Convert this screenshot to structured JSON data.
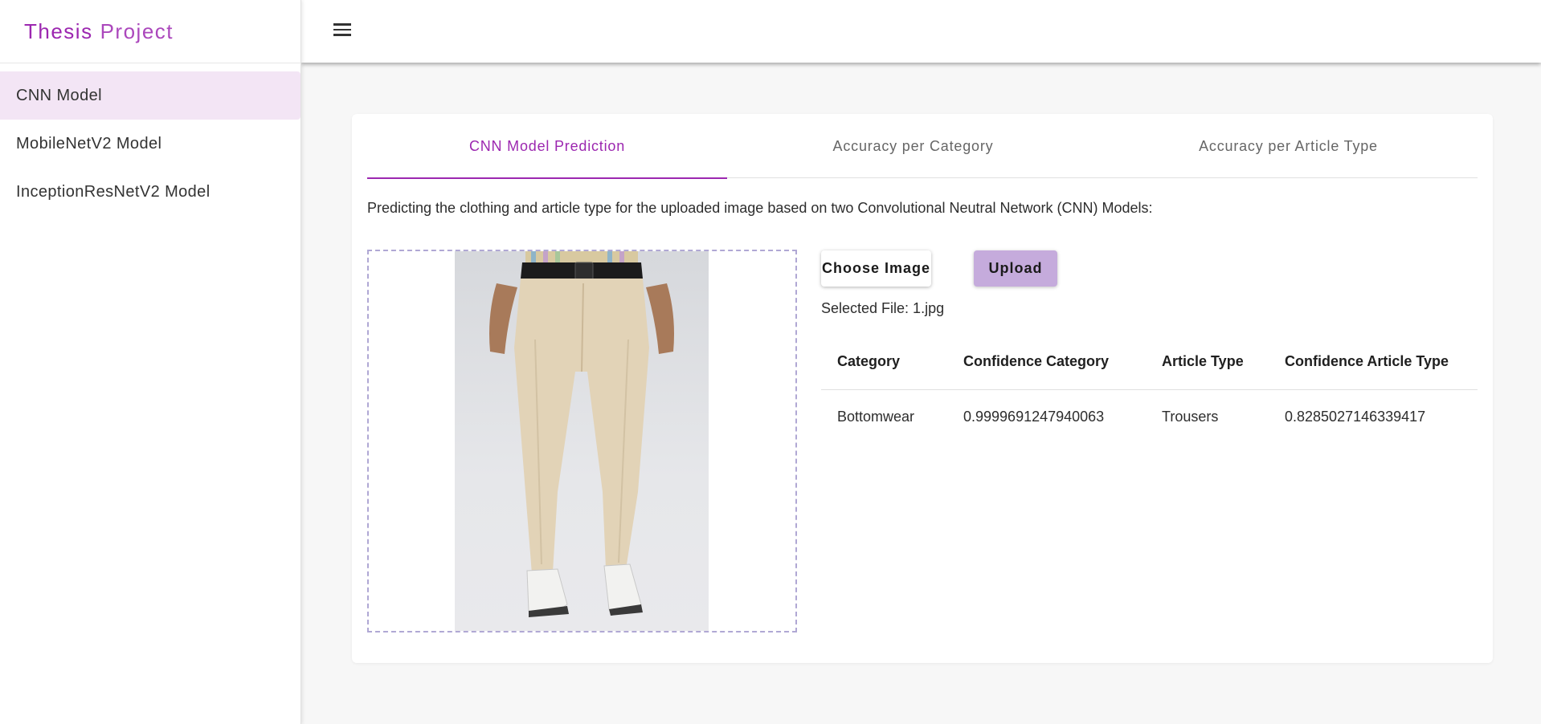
{
  "brand": {
    "word1": "Thesis",
    "word2": "Project"
  },
  "sidebar": {
    "items": [
      {
        "label": "CNN Model"
      },
      {
        "label": "MobileNetV2 Model"
      },
      {
        "label": "InceptionResNetV2 Model"
      }
    ]
  },
  "tabs": [
    {
      "label": "CNN Model Prediction"
    },
    {
      "label": "Accuracy per Category"
    },
    {
      "label": "Accuracy per Article Type"
    }
  ],
  "main": {
    "description": "Predicting the clothing and article type for the uploaded image based on two Convolutional Neutral Network (CNN) Models:",
    "choose_label": "Choose Image",
    "upload_label": "Upload",
    "selected_file": "Selected File: 1.jpg",
    "image_icon": "trousers-product-photo"
  },
  "table": {
    "headers": [
      "Category",
      "Confidence Category",
      "Article Type",
      "Confidence Article Type"
    ],
    "rows": [
      [
        "Bottomwear",
        "0.9999691247940063",
        "Trousers",
        "0.8285027146339417"
      ]
    ]
  },
  "colors": {
    "accent": "#9c27b0",
    "active_bg": "#f3e5f5",
    "upload_bg": "#c5abdc",
    "dashed_border": "#b0a8d4"
  }
}
